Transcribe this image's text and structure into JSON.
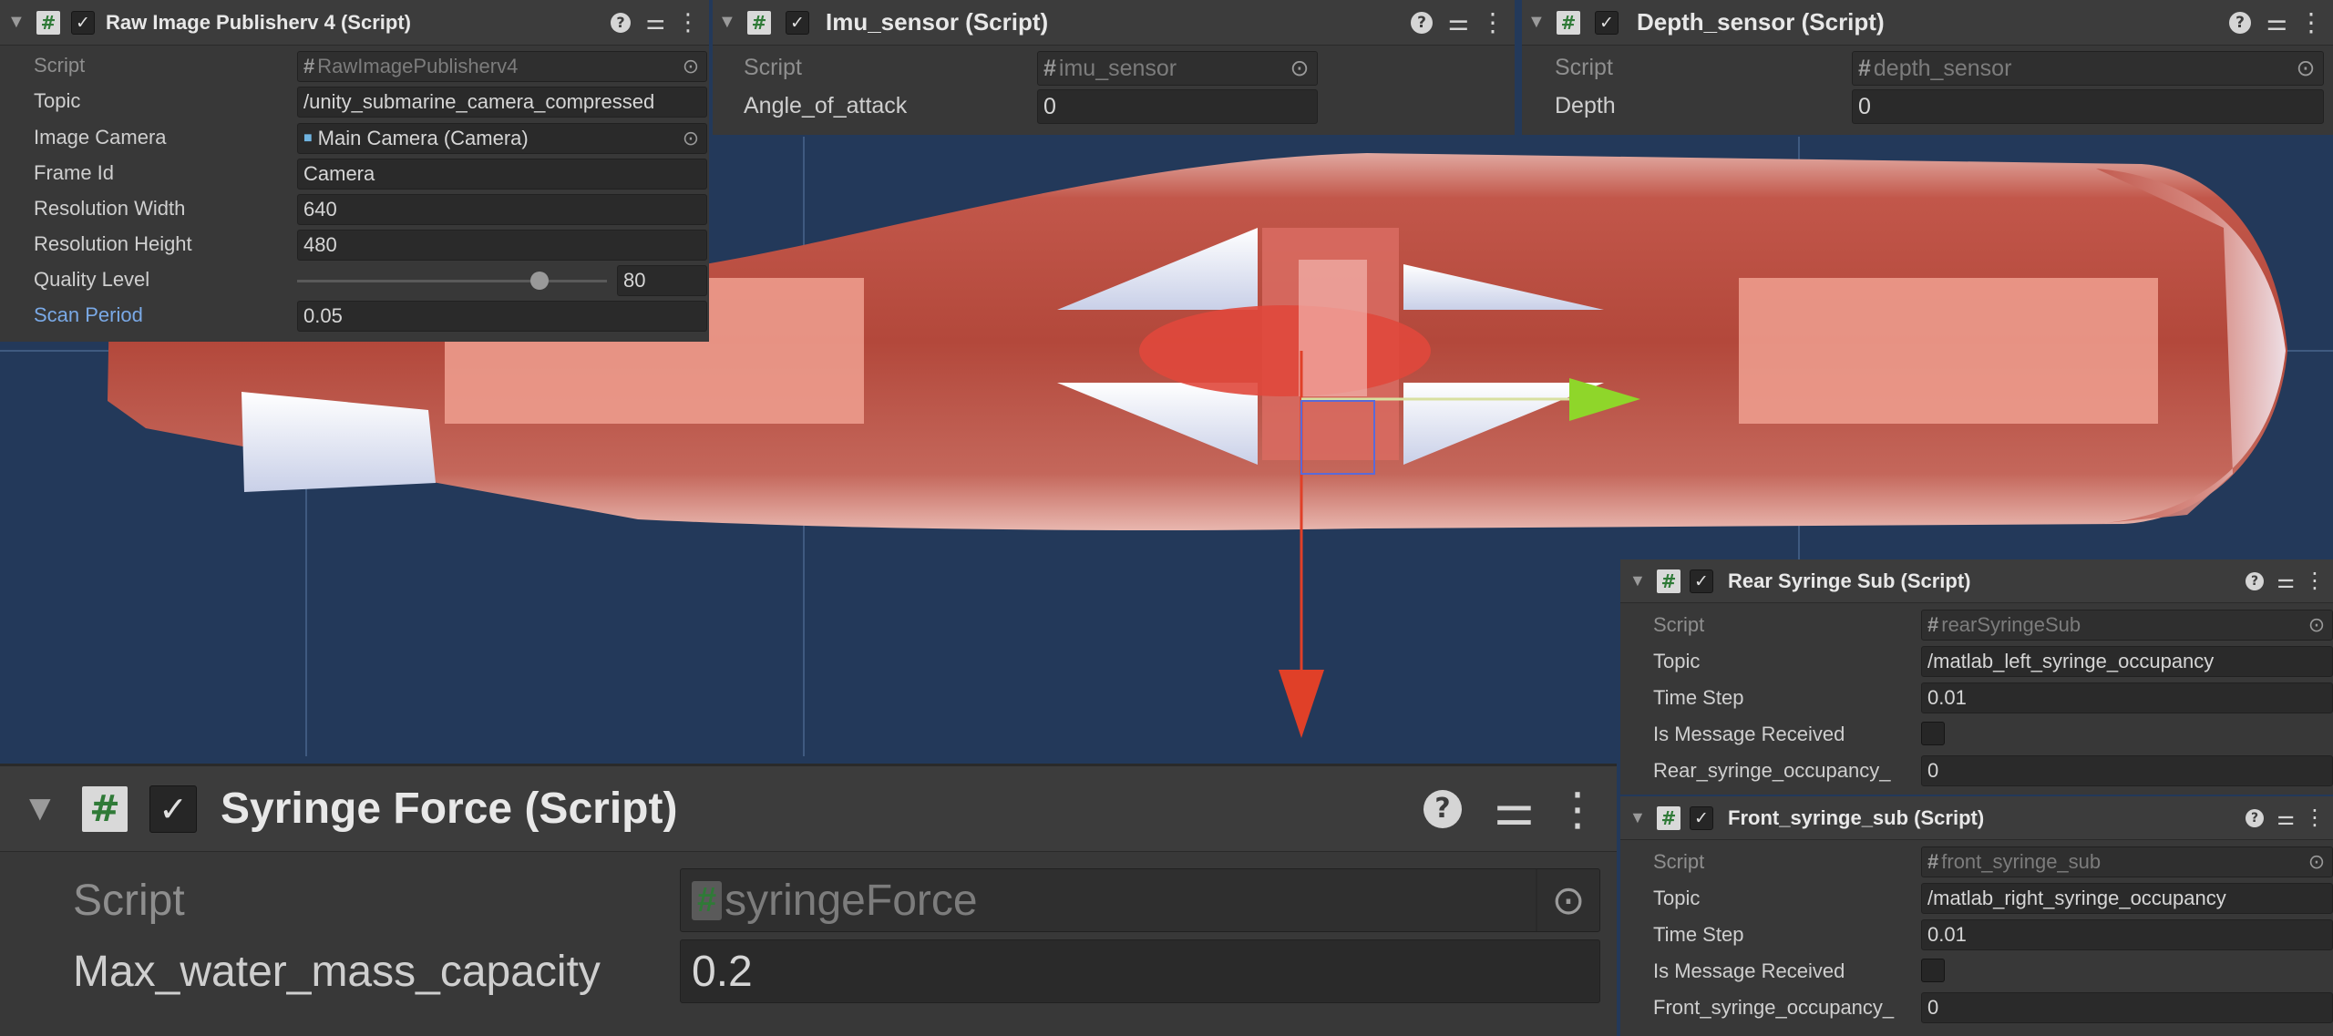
{
  "raw_image_publisher": {
    "title": "Raw Image Publisherv 4 (Script)",
    "fields": [
      {
        "label": "Script",
        "value": "RawImagePublisherv4"
      },
      {
        "label": "Topic",
        "value": "/unity_submarine_camera_compressed"
      },
      {
        "label": "Image Camera",
        "value": "Main Camera (Camera)"
      },
      {
        "label": "Frame Id",
        "value": "Camera"
      },
      {
        "label": "Resolution Width",
        "value": "640"
      },
      {
        "label": "Resolution Height",
        "value": "480"
      },
      {
        "label": "Quality Level",
        "value": "80",
        "slider_fraction": 0.8
      },
      {
        "label": "Scan Period",
        "value": "0.05"
      }
    ]
  },
  "imu_sensor": {
    "title": "Imu_sensor (Script)",
    "fields": [
      {
        "label": "Script",
        "value": "imu_sensor"
      },
      {
        "label": "Angle_of_attack",
        "value": "0"
      }
    ]
  },
  "depth_sensor": {
    "title": "Depth_sensor (Script)",
    "fields": [
      {
        "label": "Script",
        "value": "depth_sensor"
      },
      {
        "label": "Depth",
        "value": "0"
      }
    ]
  },
  "rear_syringe_sub": {
    "title": "Rear Syringe Sub (Script)",
    "fields": [
      {
        "label": "Script",
        "value": "rearSyringeSub"
      },
      {
        "label": "Topic",
        "value": "/matlab_left_syringe_occupancy"
      },
      {
        "label": "Time Step",
        "value": "0.01"
      },
      {
        "label": "Is Message Received",
        "checked": false
      },
      {
        "label": "Rear_syringe_occupancy_",
        "value": "0"
      }
    ]
  },
  "front_syringe_sub": {
    "title": "Front_syringe_sub (Script)",
    "fields": [
      {
        "label": "Script",
        "value": "front_syringe_sub"
      },
      {
        "label": "Topic",
        "value": "/matlab_right_syringe_occupancy"
      },
      {
        "label": "Time Step",
        "value": "0.01"
      },
      {
        "label": "Is Message Received",
        "checked": false
      },
      {
        "label": "Front_syringe_occupancy_",
        "value": "0"
      }
    ]
  },
  "syringe_force": {
    "title": "Syringe Force (Script)",
    "fields": [
      {
        "label": "Script",
        "value": "syringeForce"
      },
      {
        "label": "Max_water_mass_capacity",
        "value": "0.2"
      }
    ]
  },
  "icons": {
    "fold": "triangle-down-icon",
    "script": "hash-icon",
    "enabled": "checkmark-icon",
    "help": "help-icon",
    "presets": "sliders-icon",
    "menu": "kebab-menu-icon",
    "picker": "object-picker-icon",
    "camera": "camera-icon"
  },
  "colors": {
    "scene_bg": "#23395a",
    "hull": "#b0453a",
    "x_axis": "#e04028",
    "y_axis": "#8fd62a",
    "link_label": "#7aa9e6",
    "script_hash": "#2f7a37"
  }
}
